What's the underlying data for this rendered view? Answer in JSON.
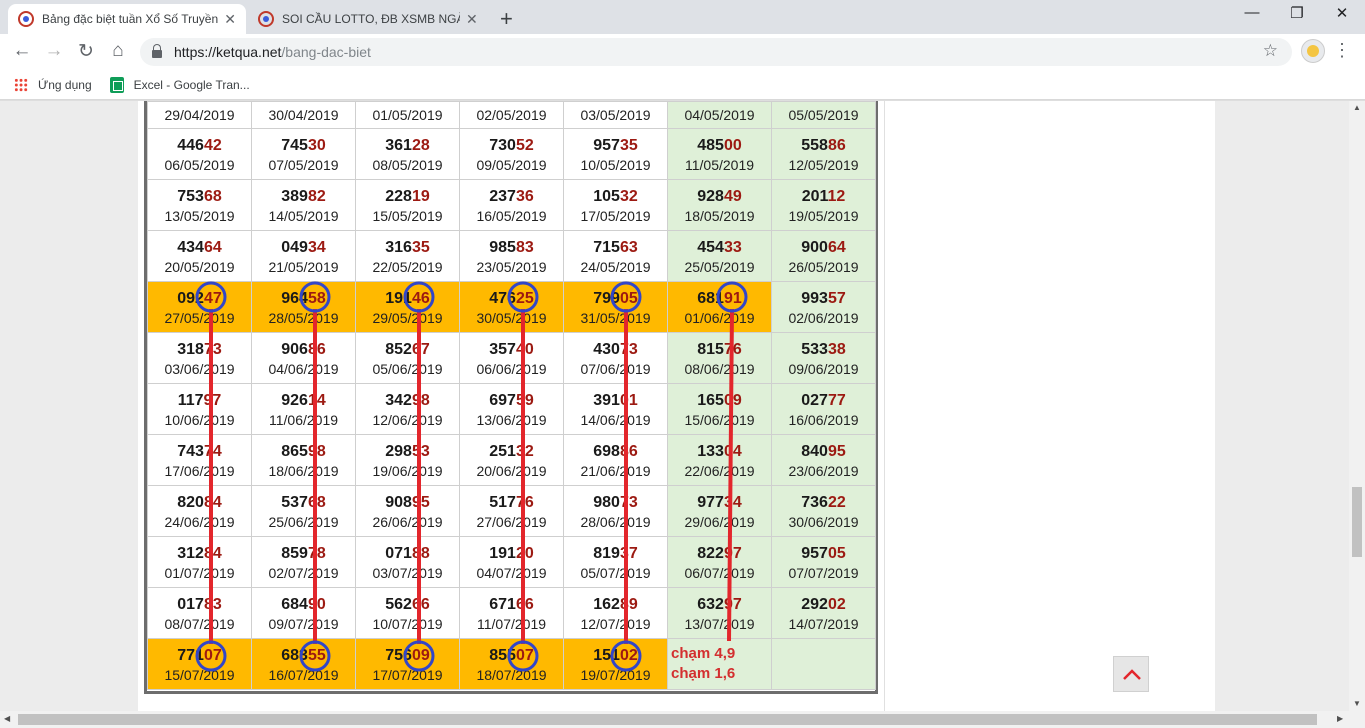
{
  "browser": {
    "tabs": [
      {
        "title": "Bảng đặc biệt tuần Xổ Số Truyền",
        "close": "✕"
      },
      {
        "title": "SOI CẦU LOTTO, ĐB XSMB NGÀY",
        "close": "✕"
      }
    ],
    "new_tab": "+",
    "window_controls": {
      "minimize": "—",
      "restore": "❐",
      "close": "✕"
    },
    "nav": {
      "back": "←",
      "forward": "→",
      "reload": "↻",
      "home": "⌂"
    },
    "url_host": "https://ketqua.net",
    "url_path": "/bang-dac-biet",
    "star": "☆",
    "menu": "⋮",
    "bookmarks": [
      {
        "label": "Ứng dụng",
        "icon": "apps-grid-icon"
      },
      {
        "label": "Excel - Google Tran...",
        "icon": "google-sheets-icon"
      }
    ]
  },
  "table": {
    "first_row_dates": [
      "29/04/2019",
      "30/04/2019",
      "01/05/2019",
      "02/05/2019",
      "03/05/2019",
      "04/05/2019",
      "05/05/2019"
    ],
    "rows": [
      [
        {
          "h": "446",
          "t": "42",
          "d": "06/05/2019"
        },
        {
          "h": "745",
          "t": "30",
          "d": "07/05/2019"
        },
        {
          "h": "361",
          "t": "28",
          "d": "08/05/2019"
        },
        {
          "h": "730",
          "t": "52",
          "d": "09/05/2019"
        },
        {
          "h": "957",
          "t": "35",
          "d": "10/05/2019"
        },
        {
          "h": "485",
          "t": "00",
          "d": "11/05/2019"
        },
        {
          "h": "558",
          "t": "86",
          "d": "12/05/2019"
        }
      ],
      [
        {
          "h": "753",
          "t": "68",
          "d": "13/05/2019"
        },
        {
          "h": "389",
          "t": "82",
          "d": "14/05/2019"
        },
        {
          "h": "228",
          "t": "19",
          "d": "15/05/2019"
        },
        {
          "h": "237",
          "t": "36",
          "d": "16/05/2019"
        },
        {
          "h": "105",
          "t": "32",
          "d": "17/05/2019"
        },
        {
          "h": "928",
          "t": "49",
          "d": "18/05/2019"
        },
        {
          "h": "201",
          "t": "12",
          "d": "19/05/2019"
        }
      ],
      [
        {
          "h": "434",
          "t": "64",
          "d": "20/05/2019"
        },
        {
          "h": "049",
          "t": "34",
          "d": "21/05/2019"
        },
        {
          "h": "316",
          "t": "35",
          "d": "22/05/2019"
        },
        {
          "h": "985",
          "t": "83",
          "d": "23/05/2019"
        },
        {
          "h": "715",
          "t": "63",
          "d": "24/05/2019"
        },
        {
          "h": "454",
          "t": "33",
          "d": "25/05/2019"
        },
        {
          "h": "900",
          "t": "64",
          "d": "26/05/2019"
        }
      ],
      [
        {
          "h": "092",
          "t": "47",
          "d": "27/05/2019"
        },
        {
          "h": "964",
          "t": "58",
          "d": "28/05/2019"
        },
        {
          "h": "191",
          "t": "46",
          "d": "29/05/2019"
        },
        {
          "h": "476",
          "t": "25",
          "d": "30/05/2019"
        },
        {
          "h": "799",
          "t": "05",
          "d": "31/05/2019"
        },
        {
          "h": "681",
          "t": "91",
          "d": "01/06/2019"
        },
        {
          "h": "993",
          "t": "57",
          "d": "02/06/2019"
        }
      ],
      [
        {
          "h": "318",
          "t": "73",
          "d": "03/06/2019"
        },
        {
          "h": "906",
          "t": "86",
          "d": "04/06/2019"
        },
        {
          "h": "852",
          "t": "67",
          "d": "05/06/2019"
        },
        {
          "h": "357",
          "t": "40",
          "d": "06/06/2019"
        },
        {
          "h": "430",
          "t": "73",
          "d": "07/06/2019"
        },
        {
          "h": "815",
          "t": "76",
          "d": "08/06/2019"
        },
        {
          "h": "533",
          "t": "38",
          "d": "09/06/2019"
        }
      ],
      [
        {
          "h": "117",
          "t": "97",
          "d": "10/06/2019"
        },
        {
          "h": "926",
          "t": "14",
          "d": "11/06/2019"
        },
        {
          "h": "342",
          "t": "98",
          "d": "12/06/2019"
        },
        {
          "h": "697",
          "t": "59",
          "d": "13/06/2019"
        },
        {
          "h": "391",
          "t": "01",
          "d": "14/06/2019"
        },
        {
          "h": "165",
          "t": "09",
          "d": "15/06/2019"
        },
        {
          "h": "027",
          "t": "77",
          "d": "16/06/2019"
        }
      ],
      [
        {
          "h": "743",
          "t": "74",
          "d": "17/06/2019"
        },
        {
          "h": "865",
          "t": "98",
          "d": "18/06/2019"
        },
        {
          "h": "298",
          "t": "53",
          "d": "19/06/2019"
        },
        {
          "h": "251",
          "t": "32",
          "d": "20/06/2019"
        },
        {
          "h": "698",
          "t": "86",
          "d": "21/06/2019"
        },
        {
          "h": "133",
          "t": "04",
          "d": "22/06/2019"
        },
        {
          "h": "840",
          "t": "95",
          "d": "23/06/2019"
        }
      ],
      [
        {
          "h": "820",
          "t": "84",
          "d": "24/06/2019"
        },
        {
          "h": "537",
          "t": "68",
          "d": "25/06/2019"
        },
        {
          "h": "908",
          "t": "95",
          "d": "26/06/2019"
        },
        {
          "h": "517",
          "t": "76",
          "d": "27/06/2019"
        },
        {
          "h": "980",
          "t": "73",
          "d": "28/06/2019"
        },
        {
          "h": "977",
          "t": "34",
          "d": "29/06/2019"
        },
        {
          "h": "736",
          "t": "22",
          "d": "30/06/2019"
        }
      ],
      [
        {
          "h": "312",
          "t": "84",
          "d": "01/07/2019"
        },
        {
          "h": "859",
          "t": "78",
          "d": "02/07/2019"
        },
        {
          "h": "071",
          "t": "88",
          "d": "03/07/2019"
        },
        {
          "h": "191",
          "t": "20",
          "d": "04/07/2019"
        },
        {
          "h": "819",
          "t": "37",
          "d": "05/07/2019"
        },
        {
          "h": "822",
          "t": "97",
          "d": "06/07/2019"
        },
        {
          "h": "957",
          "t": "05",
          "d": "07/07/2019"
        }
      ],
      [
        {
          "h": "017",
          "t": "83",
          "d": "08/07/2019"
        },
        {
          "h": "684",
          "t": "90",
          "d": "09/07/2019"
        },
        {
          "h": "562",
          "t": "66",
          "d": "10/07/2019"
        },
        {
          "h": "671",
          "t": "66",
          "d": "11/07/2019"
        },
        {
          "h": "162",
          "t": "89",
          "d": "12/07/2019"
        },
        {
          "h": "632",
          "t": "97",
          "d": "13/07/2019"
        },
        {
          "h": "292",
          "t": "02",
          "d": "14/07/2019"
        }
      ],
      [
        {
          "h": "771",
          "t": "07",
          "d": "15/07/2019"
        },
        {
          "h": "683",
          "t": "55",
          "d": "16/07/2019"
        },
        {
          "h": "756",
          "t": "09",
          "d": "17/07/2019"
        },
        {
          "h": "855",
          "t": "07",
          "d": "18/07/2019"
        },
        {
          "h": "151",
          "t": "02",
          "d": "19/07/2019"
        }
      ]
    ],
    "notes": [
      "chạm 4,9",
      "chạm 1,6"
    ],
    "annotation_colors": {
      "line": "#e3262c",
      "circle": "#3246c8",
      "highlight": "#ffb900",
      "weekend": "#dff0d8"
    }
  },
  "back_to_top": "^"
}
